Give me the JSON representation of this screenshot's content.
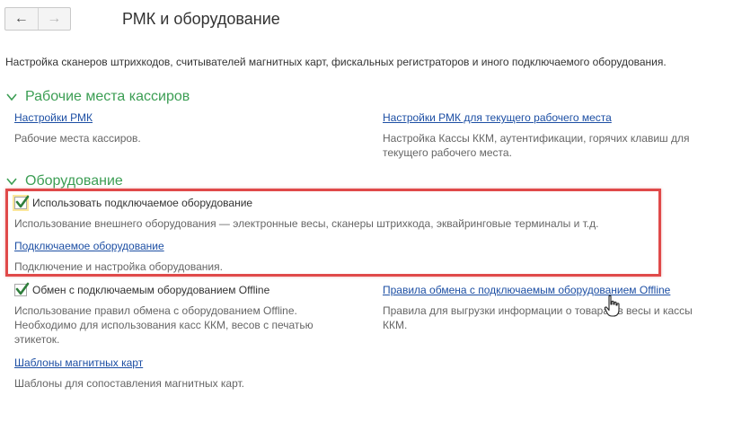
{
  "nav": {
    "back_label": "←",
    "forward_label": "→"
  },
  "page": {
    "title": "РМК и оборудование",
    "description": "Настройка сканеров штрихкодов, считывателей магнитных карт, фискальных регистраторов и иного подключаемого оборудования."
  },
  "sections": {
    "cashier": {
      "title": "Рабочие места кассиров",
      "left_link": "Настройки РМК",
      "left_hint": "Рабочие места кассиров.",
      "right_link": "Настройки РМК для текущего рабочего места",
      "right_hint_line1": "Настройка Кассы ККМ, аутентификации, горячих клавиш для",
      "right_hint_line2": "текущего рабочего места."
    },
    "equipment": {
      "title": "Оборудование",
      "use_equipment_label": "Использовать подключаемое оборудование",
      "use_equipment_checked": true,
      "use_equipment_hint": "Использование внешнего оборудования — электронные весы, сканеры штрихкода, эквайринговые терминалы и т.д.",
      "connected_link": "Подключаемое оборудование",
      "connected_hint": "Подключение и настройка оборудования.",
      "offline_label": "Обмен с подключаемым оборудованием Offline",
      "offline_checked": true,
      "offline_hint_line1": "Использование правил обмена с оборудованием Offline.",
      "offline_hint_line2": "Необходимо для использования касс ККМ, весов с печатью",
      "offline_hint_line3": "этикеток.",
      "rules_link": "Правила обмена с подключаемым оборудованием Offline",
      "rules_hint_line1": "Правила для выгрузки информации о товарах в весы и кассы",
      "rules_hint_line2": "ККМ.",
      "cards_link": "Шаблоны магнитных карт",
      "cards_hint": "Шаблоны для сопоставления магнитных карт."
    }
  },
  "colors": {
    "section_title": "#3c9e54",
    "link": "#1d4fa4",
    "highlight_box": "#e04a4a",
    "checkbox_focus": "#fbe79b"
  }
}
